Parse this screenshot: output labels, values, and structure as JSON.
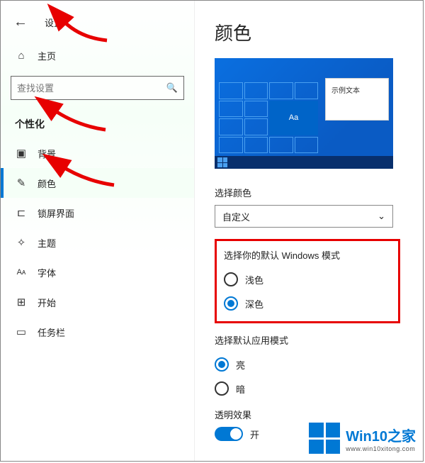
{
  "header": {
    "title": "设置"
  },
  "sidebar": {
    "home_label": "主页",
    "search_placeholder": "查找设置",
    "section_title": "个性化",
    "items": [
      {
        "label": "背景"
      },
      {
        "label": "颜色"
      },
      {
        "label": "锁屏界面"
      },
      {
        "label": "主题"
      },
      {
        "label": "字体"
      },
      {
        "label": "开始"
      },
      {
        "label": "任务栏"
      }
    ]
  },
  "main": {
    "page_title": "颜色",
    "preview_sample_text": "示例文本",
    "preview_tile_text": "Aa",
    "choose_color_label": "选择颜色",
    "choose_color_value": "自定义",
    "windows_mode_label": "选择你的默认 Windows 模式",
    "windows_mode_options": {
      "light": "浅色",
      "dark": "深色"
    },
    "app_mode_label": "选择默认应用模式",
    "app_mode_options": {
      "light": "亮",
      "dark": "暗"
    },
    "transparency_label": "透明效果",
    "transparency_value": "开"
  },
  "watermark": {
    "brand": "Win10之家",
    "url": "www.win10xitong.com"
  }
}
